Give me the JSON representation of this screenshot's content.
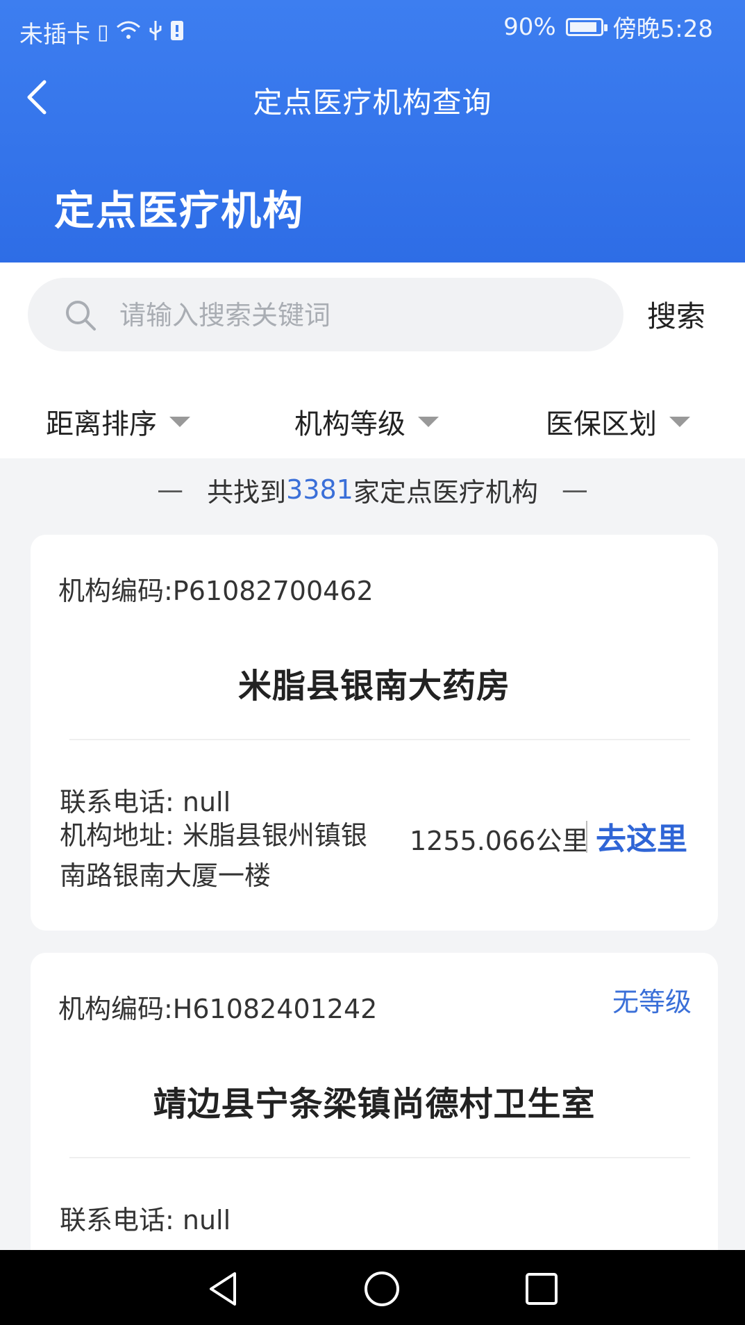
{
  "status_bar": {
    "carrier": "未插卡",
    "battery_percent": "90%",
    "battery_level": 0.9,
    "time": "傍晚5:28",
    "icons": [
      "sim-icon",
      "wifi-icon",
      "usb-icon",
      "notification-icon",
      "battery-icon"
    ]
  },
  "nav": {
    "title": "定点医疗机构查询",
    "back_icon": "chevron-left-icon"
  },
  "page": {
    "heading": "定点医疗机构"
  },
  "search": {
    "placeholder": "请输入搜索关键词",
    "value": "",
    "button_label": "搜索",
    "icon": "search-icon"
  },
  "filters": [
    {
      "label": "距离排序"
    },
    {
      "label": "机构等级"
    },
    {
      "label": "医保区划"
    }
  ],
  "result_count": {
    "prefix": "共找到",
    "count": "3381",
    "suffix": "家定点医疗机构",
    "dash": "—"
  },
  "cards": [
    {
      "code": "机构编码:P61082700462",
      "level": "",
      "name": "米脂县银南大药房",
      "phone": "联系电话:  null",
      "address": "机构地址:  米脂县银州镇银南路银南大厦一楼",
      "distance": "1255.066公里",
      "go_label": "去这里"
    },
    {
      "code": "机构编码:H61082401242",
      "level": "无等级",
      "name": "靖边县宁条梁镇尚德村卫生室",
      "phone": "联系电话:  null"
    }
  ],
  "colors": {
    "header_blue": "#2e6de6",
    "accent_blue": "#3a6fd8",
    "link_blue": "#2f65d6",
    "list_background": "#f3f4f6"
  },
  "system_nav": {
    "icons": [
      "back-triangle-icon",
      "home-circle-icon",
      "recents-square-icon"
    ]
  }
}
